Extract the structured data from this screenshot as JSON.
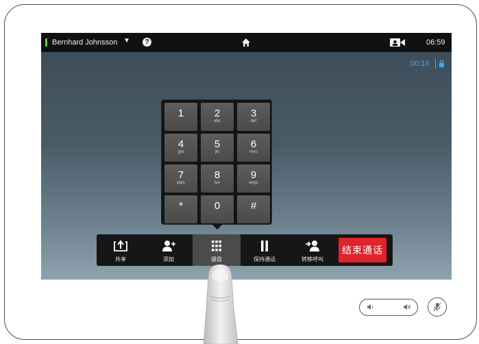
{
  "topbar": {
    "user_name": "Bernhard Johnsson",
    "dropdown_arrow": "▼",
    "help_glyph": "?",
    "clock": "06:59"
  },
  "call": {
    "duration": "00:18"
  },
  "keypad": {
    "keys": [
      {
        "digit": "1",
        "letters": ""
      },
      {
        "digit": "2",
        "letters": "abc"
      },
      {
        "digit": "3",
        "letters": "def"
      },
      {
        "digit": "4",
        "letters": "ghi"
      },
      {
        "digit": "5",
        "letters": "jkl"
      },
      {
        "digit": "6",
        "letters": "mno"
      },
      {
        "digit": "7",
        "letters": "pqrs"
      },
      {
        "digit": "8",
        "letters": "tuv"
      },
      {
        "digit": "9",
        "letters": "wxyz"
      },
      {
        "digit": "*",
        "letters": ""
      },
      {
        "digit": "0",
        "letters": ""
      },
      {
        "digit": "#",
        "letters": ""
      }
    ]
  },
  "toolbar": {
    "share_label": "共享",
    "add_label": "添加",
    "keypad_label": "键盘",
    "hold_label": "保持通话",
    "transfer_label": "转移呼叫",
    "end_call_label": "结束通话"
  },
  "colors": {
    "presence": "#62d23a",
    "accent": "#3fa9f5",
    "end_call": "#e0242b",
    "toolbar_bg": "#161616"
  },
  "icons": {
    "home": "home-icon",
    "camera": "camera-icon",
    "lock": "lock-icon",
    "share": "share-icon",
    "add": "add-user-icon",
    "keypad": "keypad-grid-icon",
    "hold": "pause-icon",
    "transfer": "transfer-icon",
    "volume_down": "volume-down-icon",
    "volume_up": "volume-up-icon",
    "mute": "mic-mute-icon"
  }
}
